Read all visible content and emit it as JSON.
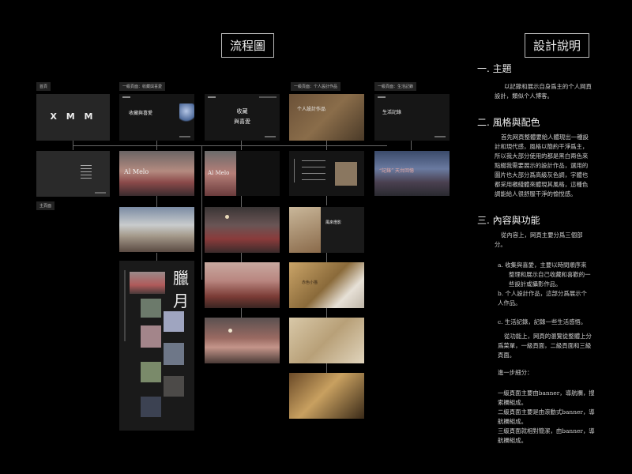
{
  "titles": {
    "flow": "流程圖",
    "design": "設計說明"
  },
  "tags": {
    "home": "首頁",
    "level1_works": "一級頁面：收藏與喜愛",
    "level1_design": "一級頁面：个人設計作品",
    "level1_life": "一級頁面：生活記錄",
    "main_page": "主頁面"
  },
  "logo_text": "X M M",
  "mockups": {
    "collect_title": "收藏與喜愛",
    "collect_title_a": "收藏",
    "collect_title_b": "與喜愛",
    "al_melo": "Al Melo",
    "design_title": "个人設計作品",
    "life_title": "生活記錄",
    "banner_text": "“記錄” 天台回憶",
    "la_chars": "臘月",
    "wind_title": "風來燈影",
    "red_cat": "赤色小猫"
  },
  "design_notes": {
    "s1_heading": "一. 主題",
    "s1_lines": [
      "以記錄和展示自身爲主的个人网頁",
      "設計，類似个人博客。"
    ],
    "s2_heading": "二. 風格與配色",
    "s2_lines": [
      "首先网頁整體要給人體現出一種設",
      "計和現代感，風格以簡約干淨爲主，",
      "所以我大部分使用的都是黑白兩色來",
      "點綴我需要展示的設計作品，選用的",
      "圖片也大部分爲高級灰色調，字體也",
      "都采用襯綫體來體現其風格，這種色",
      "調能給人很舒服干淨的愉悅感。"
    ],
    "s3_heading": "三. 內容與功能",
    "s3_lines": [
      "從內容上，网頁主要分爲三個部",
      "分。"
    ],
    "s3_a": [
      "a.  收集與喜愛，主要以時間順序來",
      "整理和展示自己收藏和喜歡的一",
      "些設計或攝影作品。"
    ],
    "s3_b": [
      "b.  个人設計作品，這部分爲展示个",
      "人作品。"
    ],
    "s3_c": "c.  生活記錄，記錄一些生活感悟。",
    "s3_func": [
      "從功能上，网頁的瀏覽從整體上分",
      "爲菜單，一級頁面，二級頁面和三級",
      "頁面。"
    ],
    "s3_further": "進一步細分：",
    "s3_levels": [
      "一級頁面主要由banner，導航欄，搜",
      "索欄組成。",
      "二級頁面主要是由滾動式banner，導",
      "航欄組成。",
      "三級頁面就相對簡潔，由banner，導",
      "航欄組成。"
    ]
  }
}
